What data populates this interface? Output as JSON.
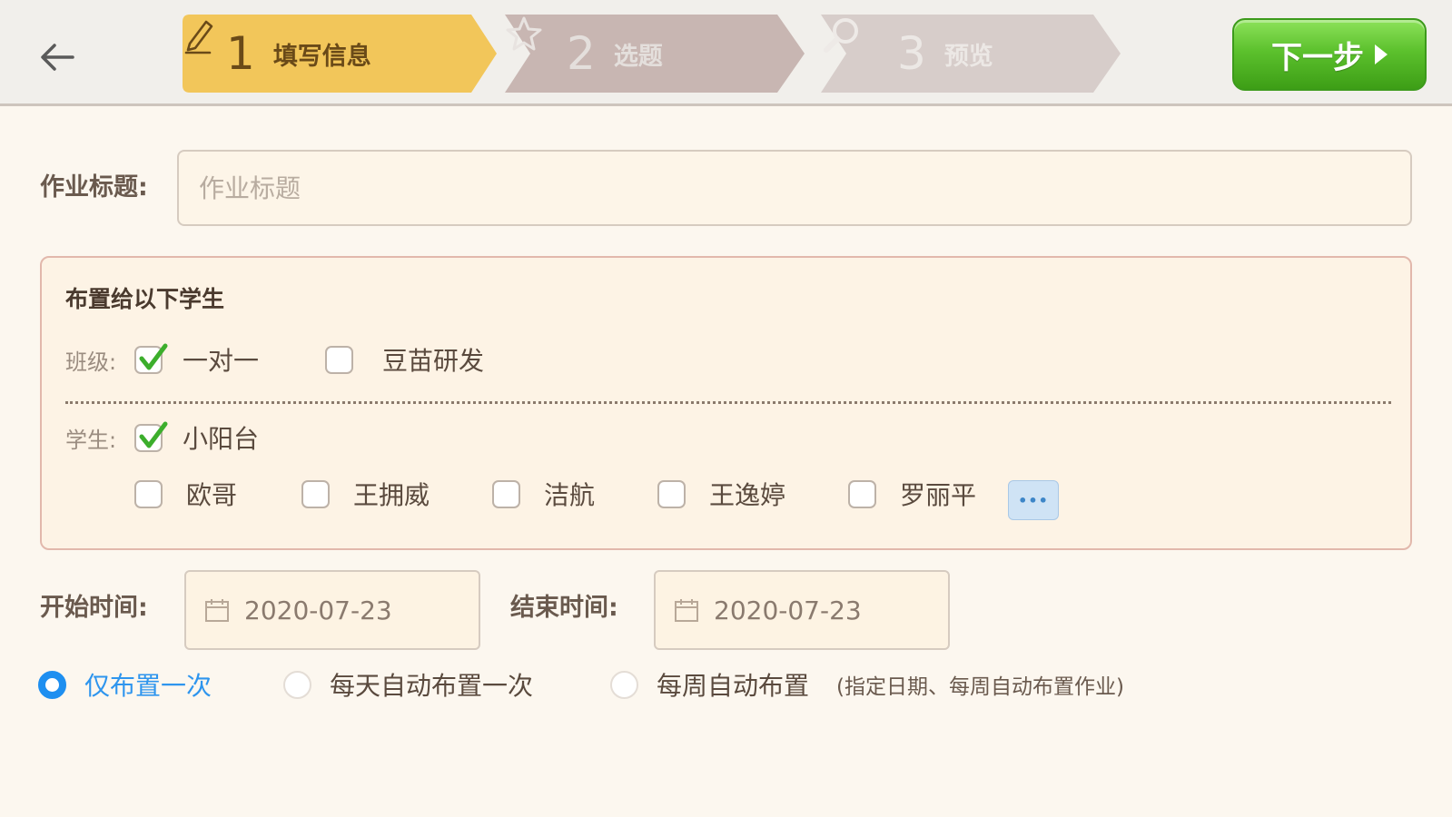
{
  "header": {
    "steps": [
      {
        "num": "1",
        "label": "填写信息",
        "icon": "pencil-icon"
      },
      {
        "num": "2",
        "label": "选题",
        "icon": "star-icon"
      },
      {
        "num": "3",
        "label": "预览",
        "icon": "search-icon"
      }
    ],
    "next_label": "下一步"
  },
  "form": {
    "title_label": "作业标题:",
    "title_placeholder": "作业标题",
    "title_value": ""
  },
  "assign": {
    "heading": "布置给以下学生",
    "class_label": "班级:",
    "classes": [
      {
        "name": "一对一",
        "checked": true
      },
      {
        "name": "豆苗研发",
        "checked": false
      }
    ],
    "student_label": "学生:",
    "students": [
      {
        "name": "小阳台",
        "checked": true
      },
      {
        "name": "欧哥",
        "checked": false
      },
      {
        "name": "王拥威",
        "checked": false
      },
      {
        "name": "洁航",
        "checked": false
      },
      {
        "name": "王逸婷",
        "checked": false
      },
      {
        "name": "罗丽平",
        "checked": false
      }
    ],
    "more_label": "•••"
  },
  "time": {
    "start_label": "开始时间:",
    "start_value": "2020-07-23",
    "end_label": "结束时间:",
    "end_value": "2020-07-23"
  },
  "schedule": {
    "options": [
      {
        "label": "仅布置一次",
        "selected": true
      },
      {
        "label": "每天自动布置一次",
        "selected": false
      },
      {
        "label": "每周自动布置",
        "selected": false
      }
    ],
    "weekly_hint": "(指定日期、每周自动布置作业)"
  },
  "colors": {
    "step_active": "#f2c65a",
    "step_inactive": "#c8b6b2",
    "next_button": "#4fb526",
    "radio_selected": "#1e8ff0",
    "checkbox_check": "#3cae2c",
    "page_background": "#fcf7ef"
  }
}
